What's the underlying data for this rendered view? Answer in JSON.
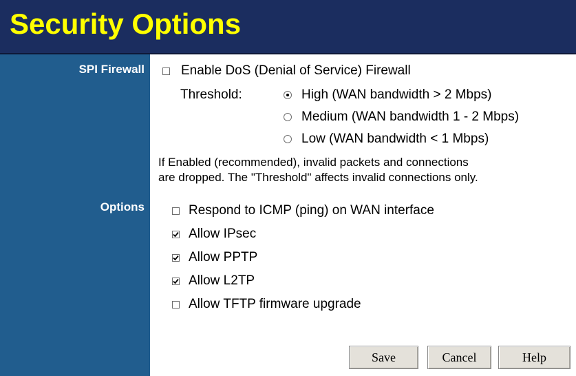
{
  "header": {
    "title": "Security Options"
  },
  "sidebar": {
    "spi_label": "SPI Firewall",
    "options_label": "Options"
  },
  "firewall": {
    "enable_dos_label": "Enable DoS (Denial of Service) Firewall",
    "enable_dos_checked": false,
    "threshold_label": "Threshold:",
    "threshold_options": [
      {
        "label": "High (WAN bandwidth > 2 Mbps)",
        "selected": true
      },
      {
        "label": "Medium (WAN bandwidth 1 - 2 Mbps)",
        "selected": false
      },
      {
        "label": "Low (WAN bandwidth < 1 Mbps)",
        "selected": false
      }
    ],
    "note_line1": "If Enabled (recommended), invalid packets and connections",
    "note_line2": "are dropped. The \"Threshold\" affects invalid connections only."
  },
  "options": [
    {
      "label": "Respond to ICMP (ping) on WAN interface",
      "checked": false
    },
    {
      "label": "Allow IPsec",
      "checked": true
    },
    {
      "label": "Allow PPTP",
      "checked": true
    },
    {
      "label": "Allow L2TP",
      "checked": true
    },
    {
      "label": "Allow TFTP firmware upgrade",
      "checked": false
    }
  ],
  "buttons": {
    "save": "Save",
    "cancel": "Cancel",
    "help": "Help"
  },
  "colors": {
    "header_bg": "#1b2d5f",
    "title_text": "#ffff00",
    "sidebar_bg": "#215d8e",
    "button_bg": "#e4e1da"
  }
}
